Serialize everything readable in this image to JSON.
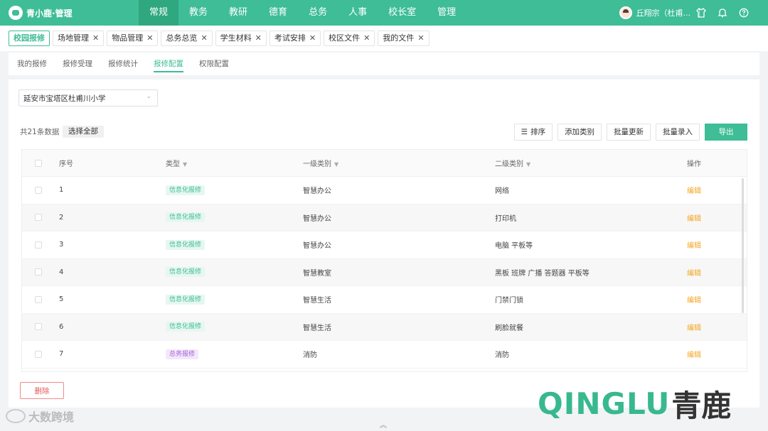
{
  "topbar": {
    "logo_text": "青小鹿·管理",
    "nav": [
      "常规",
      "教务",
      "教研",
      "德育",
      "总务",
      "人事",
      "校长室",
      "管理"
    ],
    "active_nav": 0,
    "user_name": "丘翔宗（杜甫...",
    "icons": [
      "shirt-icon",
      "bell-icon",
      "help-icon"
    ]
  },
  "tabs": [
    {
      "label": "校园报修",
      "closable": false,
      "active": true
    },
    {
      "label": "场地管理",
      "closable": true
    },
    {
      "label": "物品管理",
      "closable": true
    },
    {
      "label": "总务总览",
      "closable": true
    },
    {
      "label": "学生材料",
      "closable": true
    },
    {
      "label": "考试安排",
      "closable": true
    },
    {
      "label": "校区文件",
      "closable": true
    },
    {
      "label": "我的文件",
      "closable": true
    }
  ],
  "subnav": [
    "我的报修",
    "报修受理",
    "报修统计",
    "报修配置",
    "权限配置"
  ],
  "active_subnav": 3,
  "school_select": {
    "value": "延安市宝塔区杜甫川小学"
  },
  "summary": {
    "count_text": "共21条数据",
    "select_all": "选择全部"
  },
  "toolbar": {
    "sort": "排序",
    "add_category": "添加类别",
    "batch_update": "批量更新",
    "batch_entry": "批量录入",
    "export": "导出"
  },
  "table": {
    "headers": {
      "no": "序号",
      "type": "类型",
      "level1": "一级类别",
      "level2": "二级类别",
      "action": "操作"
    },
    "rows": [
      {
        "no": "1",
        "type": "信息化报修",
        "type_kind": "info",
        "level1": "智慧办公",
        "level2": "网络",
        "action": "编辑"
      },
      {
        "no": "2",
        "type": "信息化报修",
        "type_kind": "info",
        "level1": "智慧办公",
        "level2": "打印机",
        "action": "编辑"
      },
      {
        "no": "3",
        "type": "信息化报修",
        "type_kind": "info",
        "level1": "智慧办公",
        "level2": "电脑 平板等",
        "action": "编辑"
      },
      {
        "no": "4",
        "type": "信息化报修",
        "type_kind": "info",
        "level1": "智慧教室",
        "level2": "黑板 班牌 广播 答题器 平板等",
        "action": "编辑"
      },
      {
        "no": "5",
        "type": "信息化报修",
        "type_kind": "info",
        "level1": "智慧生活",
        "level2": "门禁门锁",
        "action": "编辑"
      },
      {
        "no": "6",
        "type": "信息化报修",
        "type_kind": "info",
        "level1": "智慧生活",
        "level2": "刷脸就餐",
        "action": "编辑"
      },
      {
        "no": "7",
        "type": "总务报修",
        "type_kind": "general",
        "level1": "消防",
        "level2": "消防",
        "action": "编辑"
      }
    ]
  },
  "delete_label": "删除",
  "watermark": {
    "left": "大数跨境",
    "brand_latin": "QINGLU",
    "brand_cjk": "青鹿"
  },
  "colors": {
    "accent": "#3ebd96",
    "edit": "#f5a623",
    "delete": "#e55b5b",
    "general_tag": "#a462d6"
  }
}
